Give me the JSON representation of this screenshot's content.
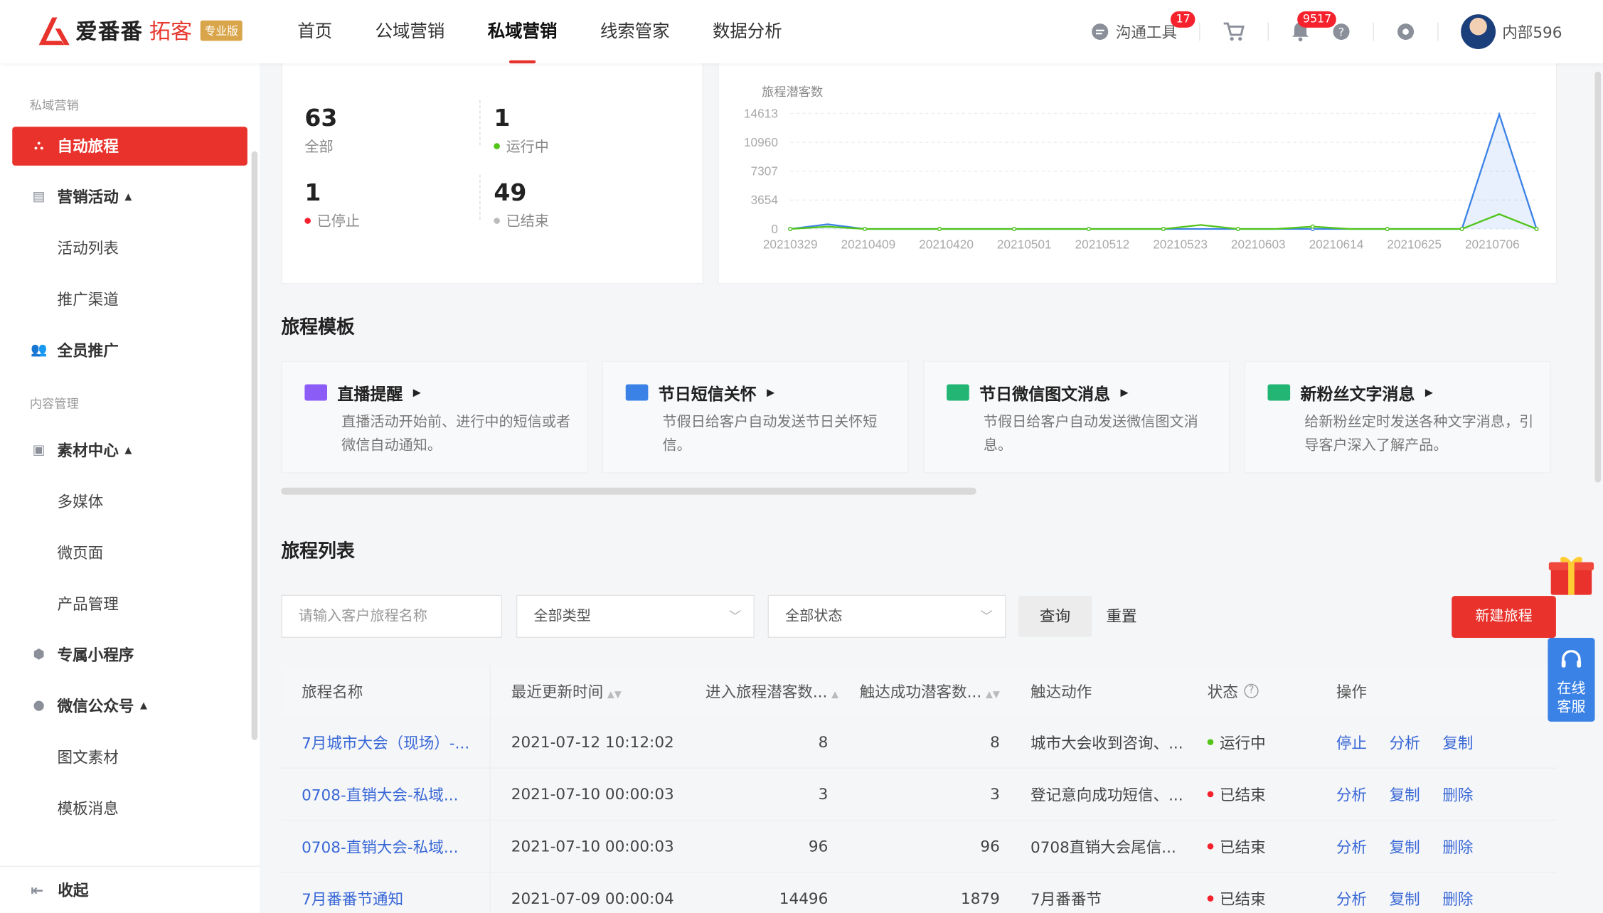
{
  "header": {
    "logo_text": "爱番番",
    "logo_sub": "拓客",
    "logo_badge": "专业版",
    "nav": [
      "首页",
      "公域营销",
      "私域营销",
      "线索管家",
      "数据分析"
    ],
    "nav_active": "私域营销",
    "comm_tool": "沟通工具",
    "comm_badge": "17",
    "notify_badge": "9517",
    "username": "内部596",
    "accent": "#e8322b"
  },
  "sidebar": {
    "group1": "私域营销",
    "active": "自动旅程",
    "marketing": "营销活动",
    "activity_list": "活动列表",
    "channel": "推广渠道",
    "staff": "全员推广",
    "group2": "内容管理",
    "material": "素材中心",
    "media": "多媒体",
    "micropage": "微页面",
    "product": "产品管理",
    "miniapp": "专属小程序",
    "wechat": "微信公众号",
    "article": "图文素材",
    "template_msg": "模板消息",
    "collapse": "收起"
  },
  "stats": {
    "all_num": "63",
    "all_label": "全部",
    "running_num": "1",
    "running_label": "运行中",
    "stopped_num": "1",
    "stopped_label": "已停止",
    "ended_num": "49",
    "ended_label": "已结束"
  },
  "chart_data": {
    "type": "line",
    "title": "",
    "ylabel": "旅程潜客数",
    "yticks": [
      "14613",
      "10960",
      "7307",
      "3654",
      "0"
    ],
    "categories": [
      "20210329",
      "20210409",
      "20210420",
      "20210501",
      "20210512",
      "20210523",
      "20210603",
      "20210614",
      "20210625",
      "20210706"
    ],
    "ylim": [
      0,
      14613
    ],
    "series": [
      {
        "color": "#3b82e6",
        "values": [
          0,
          600,
          0,
          0,
          0,
          0,
          0,
          0,
          0,
          0,
          0,
          0,
          0,
          0,
          0,
          0,
          0,
          0,
          0,
          14496,
          0
        ]
      },
      {
        "color": "#52c41a",
        "values": [
          0,
          300,
          0,
          0,
          0,
          0,
          0,
          0,
          0,
          0,
          0,
          500,
          0,
          0,
          300,
          0,
          0,
          0,
          0,
          1879,
          0
        ]
      }
    ]
  },
  "templates": {
    "section_title": "旅程模板",
    "items": [
      {
        "title": "直播提醒",
        "desc": "直播活动开始前、进行中的短信或者微信自动通知。",
        "color": "#8b5cf6"
      },
      {
        "title": "节日短信关怀",
        "desc": "节假日给客户自动发送节日关怀短信。",
        "color": "#3b82e6"
      },
      {
        "title": "节日微信图文消息",
        "desc": "节假日给客户自动发送微信图文消息。",
        "color": "#22b573"
      },
      {
        "title": "新粉丝文字消息",
        "desc": "给新粉丝定时发送各种文字消息，引导客户深入了解产品。",
        "color": "#22b573"
      }
    ]
  },
  "list": {
    "section_title": "旅程列表",
    "search_placeholder": "请输入客户旅程名称",
    "type_select": "全部类型",
    "status_select": "全部状态",
    "query": "查询",
    "reset": "重置",
    "new": "新建旅程",
    "columns": [
      "旅程名称",
      "最近更新时间",
      "进入旅程潜客数...",
      "触达成功潜客数...",
      "触达动作",
      "状态",
      "操作"
    ],
    "rows": [
      {
        "name": "7月城市大会（现场）-...",
        "time": "2021-07-12 10:12:02",
        "enter": "8",
        "reach": "8",
        "action": "城市大会收到咨询、...",
        "status": "运行中",
        "status_color": "#52c41a",
        "ops": [
          "停止",
          "分析",
          "复制"
        ]
      },
      {
        "name": "0708-直销大会-私域...",
        "time": "2021-07-10 00:00:03",
        "enter": "3",
        "reach": "3",
        "action": "登记意向成功短信、...",
        "status": "已结束",
        "status_color": "#f5222d",
        "ops": [
          "分析",
          "复制",
          "删除"
        ]
      },
      {
        "name": "0708-直销大会-私域...",
        "time": "2021-07-10 00:00:03",
        "enter": "96",
        "reach": "96",
        "action": "0708直销大会尾信...",
        "status": "已结束",
        "status_color": "#f5222d",
        "ops": [
          "分析",
          "复制",
          "删除"
        ]
      },
      {
        "name": "7月番番节通知",
        "time": "2021-07-09 00:00:04",
        "enter": "14496",
        "reach": "1879",
        "action": "7月番番节",
        "status": "已结束",
        "status_color": "#f5222d",
        "ops": [
          "分析",
          "复制",
          "删除"
        ]
      }
    ]
  },
  "service": {
    "label": "在线客服"
  }
}
